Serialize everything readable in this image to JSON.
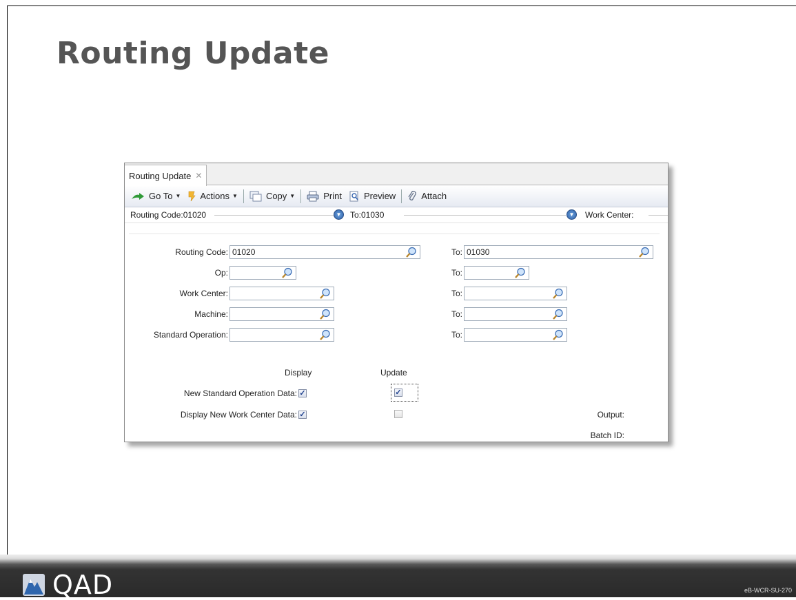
{
  "slide": {
    "title": "Routing Update",
    "footer_code": "eB-WCR-SU-270",
    "logo_text": "QAD"
  },
  "window": {
    "tab_label": "Routing Update",
    "toolbar": {
      "goto_label": "Go To",
      "actions_label": "Actions",
      "copy_label": "Copy",
      "print_label": "Print",
      "preview_label": "Preview",
      "attach_label": "Attach"
    },
    "summary": {
      "routing_code": "Routing Code:01020",
      "to": "To:01030",
      "work_center": "Work Center:"
    },
    "form": {
      "routing_code_label": "Routing Code:",
      "routing_code_value": "01020",
      "routing_code_to_label": "To:",
      "routing_code_to_value": "01030",
      "op_label": "Op:",
      "op_value": "",
      "op_to_label": "To:",
      "op_to_value": "",
      "work_center_label": "Work Center:",
      "work_center_value": "",
      "work_center_to_label": "To:",
      "work_center_to_value": "",
      "machine_label": "Machine:",
      "machine_value": "",
      "machine_to_label": "To:",
      "machine_to_value": "",
      "std_op_label": "Standard Operation:",
      "std_op_value": "",
      "std_op_to_label": "To:",
      "std_op_to_value": "",
      "display_header": "Display",
      "update_header": "Update",
      "new_std_op_label": "New Standard Operation Data:",
      "new_wc_label": "Display New Work Center Data:",
      "new_std_op_display": true,
      "new_std_op_update": true,
      "new_wc_display": true,
      "new_wc_update": false,
      "output_label": "Output:",
      "batch_id_label": "Batch ID:"
    }
  },
  "colors": {
    "footer_dark": "#2a2a2a",
    "title_gray": "#555555",
    "toolbar_blue": "#e6eaf2",
    "check_blue": "#1c3f8c"
  }
}
